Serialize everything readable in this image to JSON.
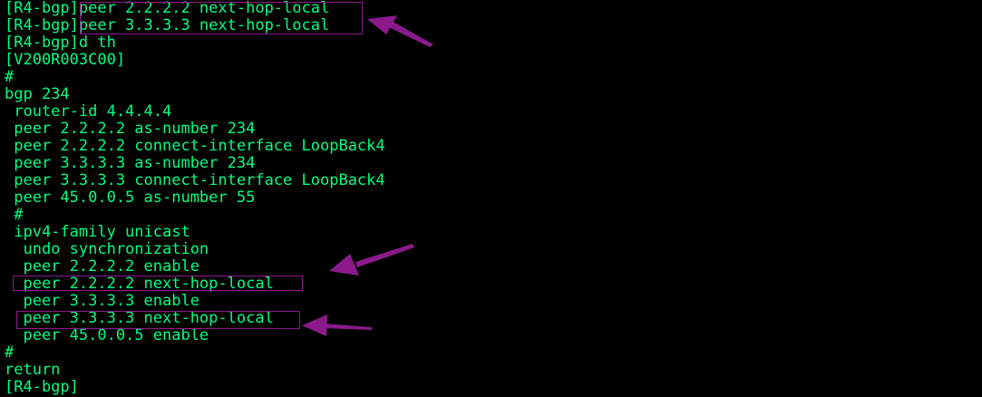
{
  "colors": {
    "background": "#000000",
    "text": "#00ff7f",
    "annotation": "#8b1a8b"
  },
  "terminal": {
    "lines": [
      "[R4-bgp]peer 2.2.2.2 next-hop-local",
      "[R4-bgp]peer 3.3.3.3 next-hop-local",
      "[R4-bgp]d th",
      "[V200R003C00]",
      "#",
      "bgp 234",
      " router-id 4.4.4.4",
      " peer 2.2.2.2 as-number 234",
      " peer 2.2.2.2 connect-interface LoopBack4",
      " peer 3.3.3.3 as-number 234",
      " peer 3.3.3.3 connect-interface LoopBack4",
      " peer 45.0.0.5 as-number 55",
      " #",
      " ipv4-family unicast",
      "  undo synchronization",
      "  peer 2.2.2.2 enable",
      "  peer 2.2.2.2 next-hop-local",
      "  peer 3.3.3.3 enable",
      "  peer 3.3.3.3 next-hop-local",
      "  peer 45.0.0.5 enable",
      "#",
      "return",
      "[R4-bgp]"
    ]
  }
}
